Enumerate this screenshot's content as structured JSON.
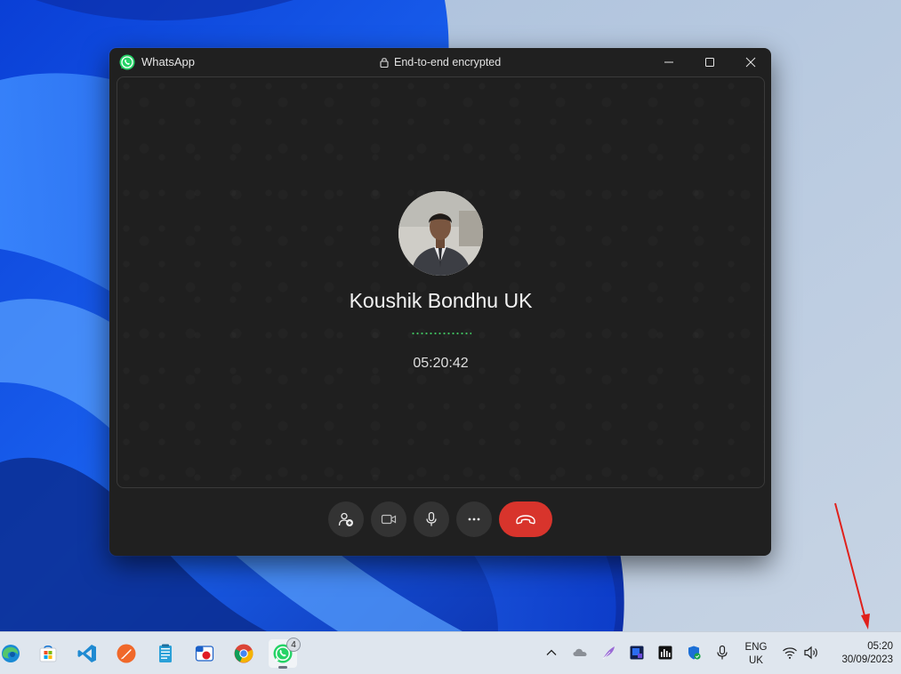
{
  "window": {
    "app_name": "WhatsApp",
    "encryption_label": "End-to-end encrypted"
  },
  "call": {
    "contact_name": "Koushik Bondhu UK",
    "duration": "05:20:42",
    "status_color": "#3fbf5f",
    "end_call_color": "#d8342c"
  },
  "controls": {
    "icons": [
      "add-participant-icon",
      "video-icon",
      "microphone-icon",
      "more-icon",
      "end-call-icon"
    ]
  },
  "taskbar": {
    "apps": [
      "edge-icon",
      "microsoft-store-icon",
      "vscode-icon",
      "sketch-app-icon",
      "notepad-icon",
      "snipping-tool-icon",
      "chrome-icon",
      "whatsapp-icon"
    ],
    "whatsapp_badge": "4",
    "language_line1": "ENG",
    "language_line2": "UK",
    "time": "05:20",
    "date": "30/09/2023"
  },
  "annotation_color": "#e0201b"
}
